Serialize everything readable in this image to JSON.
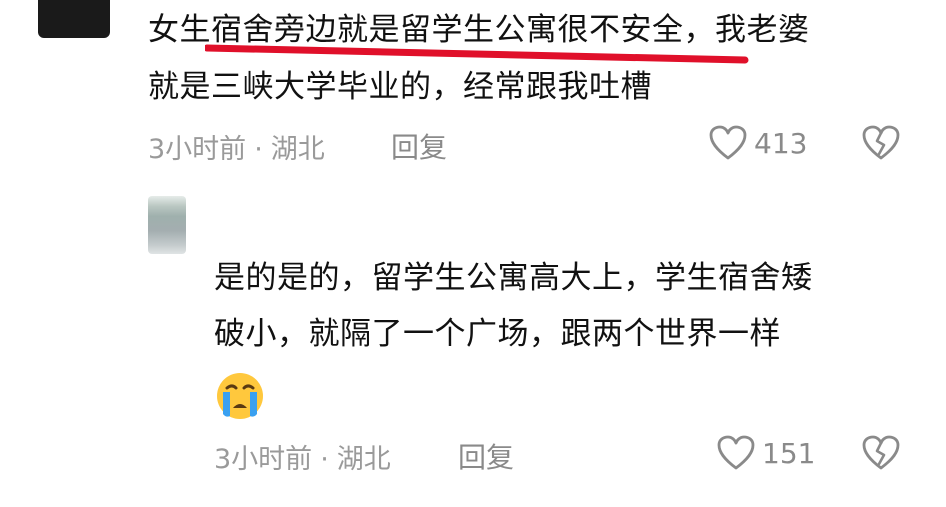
{
  "comments": [
    {
      "text_line1": "女生宿舍旁边就是留学生公寓很不安全，我老婆",
      "text_line2": "就是三峡大学毕业的，经常跟我吐槽",
      "time": "3小时前",
      "location": "湖北",
      "separator": "·",
      "reply_label": "回复",
      "likes": "413",
      "highlight_color": "#e0102a"
    },
    {
      "text_line1": "是的是的，留学生公寓高大上，学生宿舍矮",
      "text_line2": "破小，就隔了一个广场，跟两个世界一样",
      "emoji": "crying-face",
      "time": "3小时前",
      "location": "湖北",
      "separator": "·",
      "reply_label": "回复",
      "likes": "151"
    }
  ],
  "colors": {
    "text": "#111111",
    "meta": "#9a9a9a",
    "icon": "#8a8a8a",
    "emoji_face": "#ffc83d",
    "emoji_tear": "#3aa0f0"
  }
}
